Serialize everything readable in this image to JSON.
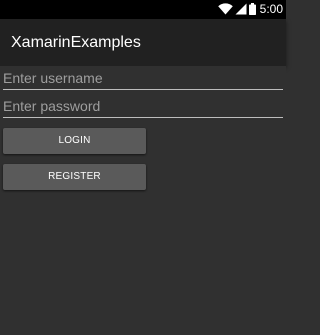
{
  "status_bar": {
    "time": "5:00",
    "icons": [
      "wifi-icon",
      "signal-icon",
      "battery-icon"
    ]
  },
  "app_bar": {
    "title": "XamarinExamples"
  },
  "form": {
    "username_placeholder": "Enter username",
    "username_value": "",
    "password_placeholder": "Enter password",
    "password_value": "",
    "login_label": "LOGIN",
    "register_label": "REGISTER"
  },
  "colors": {
    "background": "#303030",
    "app_bar": "#212121",
    "status_bar": "#000000",
    "button": "#5a5a5a",
    "text": "#ffffff",
    "hint": "#9e9e9e"
  }
}
